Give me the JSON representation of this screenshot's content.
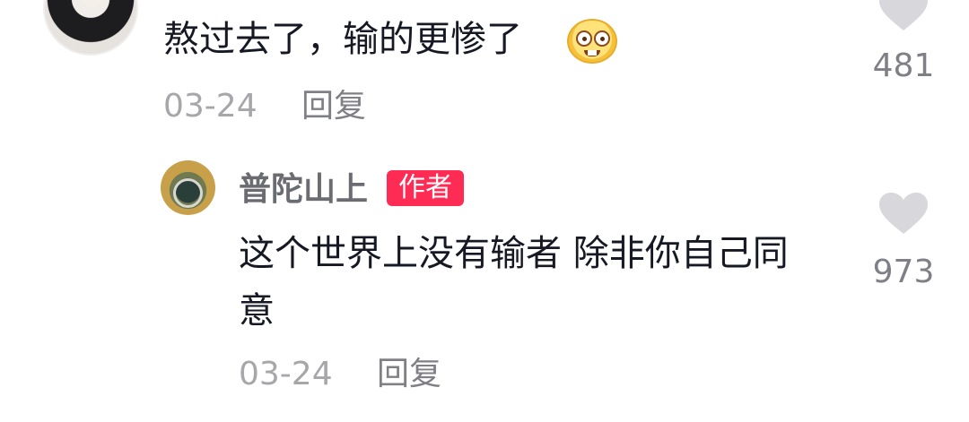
{
  "comments": [
    {
      "text": "熬过去了，输的更惨了",
      "emoji": "nerd-face-emoji",
      "date": "03-24",
      "reply_label": "回复",
      "like_count": "481",
      "replies": [
        {
          "author": "普陀山上",
          "author_badge": "作者",
          "text_line1": "这个世界上没有输者 除非你自己同",
          "text_line2": "意",
          "date": "03-24",
          "reply_label": "回复",
          "like_count": "973"
        }
      ]
    }
  ],
  "colors": {
    "badge": "#fe2c55",
    "heart": "#d8d8dc",
    "meta": "#a6a6ab",
    "text": "#161823"
  }
}
